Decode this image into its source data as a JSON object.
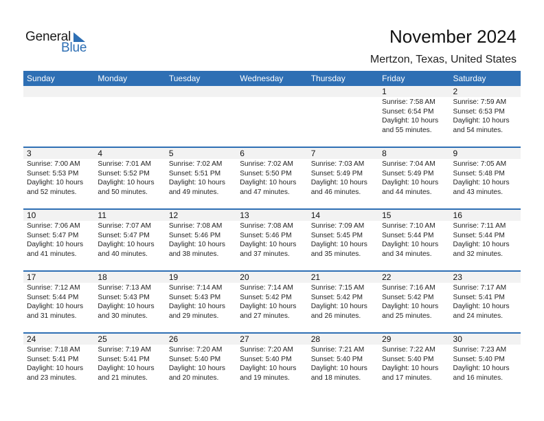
{
  "logo": {
    "line1": "General",
    "line2": "Blue"
  },
  "header": {
    "title": "November 2024",
    "location": "Mertzon, Texas, United States"
  },
  "weekdays": [
    "Sunday",
    "Monday",
    "Tuesday",
    "Wednesday",
    "Thursday",
    "Friday",
    "Saturday"
  ],
  "weeks": [
    [
      {
        "date": "",
        "sunrise": "",
        "sunset": "",
        "daylight1": "",
        "daylight2": ""
      },
      {
        "date": "",
        "sunrise": "",
        "sunset": "",
        "daylight1": "",
        "daylight2": ""
      },
      {
        "date": "",
        "sunrise": "",
        "sunset": "",
        "daylight1": "",
        "daylight2": ""
      },
      {
        "date": "",
        "sunrise": "",
        "sunset": "",
        "daylight1": "",
        "daylight2": ""
      },
      {
        "date": "",
        "sunrise": "",
        "sunset": "",
        "daylight1": "",
        "daylight2": ""
      },
      {
        "date": "1",
        "sunrise": "Sunrise: 7:58 AM",
        "sunset": "Sunset: 6:54 PM",
        "daylight1": "Daylight: 10 hours",
        "daylight2": "and 55 minutes."
      },
      {
        "date": "2",
        "sunrise": "Sunrise: 7:59 AM",
        "sunset": "Sunset: 6:53 PM",
        "daylight1": "Daylight: 10 hours",
        "daylight2": "and 54 minutes."
      }
    ],
    [
      {
        "date": "3",
        "sunrise": "Sunrise: 7:00 AM",
        "sunset": "Sunset: 5:53 PM",
        "daylight1": "Daylight: 10 hours",
        "daylight2": "and 52 minutes."
      },
      {
        "date": "4",
        "sunrise": "Sunrise: 7:01 AM",
        "sunset": "Sunset: 5:52 PM",
        "daylight1": "Daylight: 10 hours",
        "daylight2": "and 50 minutes."
      },
      {
        "date": "5",
        "sunrise": "Sunrise: 7:02 AM",
        "sunset": "Sunset: 5:51 PM",
        "daylight1": "Daylight: 10 hours",
        "daylight2": "and 49 minutes."
      },
      {
        "date": "6",
        "sunrise": "Sunrise: 7:02 AM",
        "sunset": "Sunset: 5:50 PM",
        "daylight1": "Daylight: 10 hours",
        "daylight2": "and 47 minutes."
      },
      {
        "date": "7",
        "sunrise": "Sunrise: 7:03 AM",
        "sunset": "Sunset: 5:49 PM",
        "daylight1": "Daylight: 10 hours",
        "daylight2": "and 46 minutes."
      },
      {
        "date": "8",
        "sunrise": "Sunrise: 7:04 AM",
        "sunset": "Sunset: 5:49 PM",
        "daylight1": "Daylight: 10 hours",
        "daylight2": "and 44 minutes."
      },
      {
        "date": "9",
        "sunrise": "Sunrise: 7:05 AM",
        "sunset": "Sunset: 5:48 PM",
        "daylight1": "Daylight: 10 hours",
        "daylight2": "and 43 minutes."
      }
    ],
    [
      {
        "date": "10",
        "sunrise": "Sunrise: 7:06 AM",
        "sunset": "Sunset: 5:47 PM",
        "daylight1": "Daylight: 10 hours",
        "daylight2": "and 41 minutes."
      },
      {
        "date": "11",
        "sunrise": "Sunrise: 7:07 AM",
        "sunset": "Sunset: 5:47 PM",
        "daylight1": "Daylight: 10 hours",
        "daylight2": "and 40 minutes."
      },
      {
        "date": "12",
        "sunrise": "Sunrise: 7:08 AM",
        "sunset": "Sunset: 5:46 PM",
        "daylight1": "Daylight: 10 hours",
        "daylight2": "and 38 minutes."
      },
      {
        "date": "13",
        "sunrise": "Sunrise: 7:08 AM",
        "sunset": "Sunset: 5:46 PM",
        "daylight1": "Daylight: 10 hours",
        "daylight2": "and 37 minutes."
      },
      {
        "date": "14",
        "sunrise": "Sunrise: 7:09 AM",
        "sunset": "Sunset: 5:45 PM",
        "daylight1": "Daylight: 10 hours",
        "daylight2": "and 35 minutes."
      },
      {
        "date": "15",
        "sunrise": "Sunrise: 7:10 AM",
        "sunset": "Sunset: 5:44 PM",
        "daylight1": "Daylight: 10 hours",
        "daylight2": "and 34 minutes."
      },
      {
        "date": "16",
        "sunrise": "Sunrise: 7:11 AM",
        "sunset": "Sunset: 5:44 PM",
        "daylight1": "Daylight: 10 hours",
        "daylight2": "and 32 minutes."
      }
    ],
    [
      {
        "date": "17",
        "sunrise": "Sunrise: 7:12 AM",
        "sunset": "Sunset: 5:44 PM",
        "daylight1": "Daylight: 10 hours",
        "daylight2": "and 31 minutes."
      },
      {
        "date": "18",
        "sunrise": "Sunrise: 7:13 AM",
        "sunset": "Sunset: 5:43 PM",
        "daylight1": "Daylight: 10 hours",
        "daylight2": "and 30 minutes."
      },
      {
        "date": "19",
        "sunrise": "Sunrise: 7:14 AM",
        "sunset": "Sunset: 5:43 PM",
        "daylight1": "Daylight: 10 hours",
        "daylight2": "and 29 minutes."
      },
      {
        "date": "20",
        "sunrise": "Sunrise: 7:14 AM",
        "sunset": "Sunset: 5:42 PM",
        "daylight1": "Daylight: 10 hours",
        "daylight2": "and 27 minutes."
      },
      {
        "date": "21",
        "sunrise": "Sunrise: 7:15 AM",
        "sunset": "Sunset: 5:42 PM",
        "daylight1": "Daylight: 10 hours",
        "daylight2": "and 26 minutes."
      },
      {
        "date": "22",
        "sunrise": "Sunrise: 7:16 AM",
        "sunset": "Sunset: 5:42 PM",
        "daylight1": "Daylight: 10 hours",
        "daylight2": "and 25 minutes."
      },
      {
        "date": "23",
        "sunrise": "Sunrise: 7:17 AM",
        "sunset": "Sunset: 5:41 PM",
        "daylight1": "Daylight: 10 hours",
        "daylight2": "and 24 minutes."
      }
    ],
    [
      {
        "date": "24",
        "sunrise": "Sunrise: 7:18 AM",
        "sunset": "Sunset: 5:41 PM",
        "daylight1": "Daylight: 10 hours",
        "daylight2": "and 23 minutes."
      },
      {
        "date": "25",
        "sunrise": "Sunrise: 7:19 AM",
        "sunset": "Sunset: 5:41 PM",
        "daylight1": "Daylight: 10 hours",
        "daylight2": "and 21 minutes."
      },
      {
        "date": "26",
        "sunrise": "Sunrise: 7:20 AM",
        "sunset": "Sunset: 5:40 PM",
        "daylight1": "Daylight: 10 hours",
        "daylight2": "and 20 minutes."
      },
      {
        "date": "27",
        "sunrise": "Sunrise: 7:20 AM",
        "sunset": "Sunset: 5:40 PM",
        "daylight1": "Daylight: 10 hours",
        "daylight2": "and 19 minutes."
      },
      {
        "date": "28",
        "sunrise": "Sunrise: 7:21 AM",
        "sunset": "Sunset: 5:40 PM",
        "daylight1": "Daylight: 10 hours",
        "daylight2": "and 18 minutes."
      },
      {
        "date": "29",
        "sunrise": "Sunrise: 7:22 AM",
        "sunset": "Sunset: 5:40 PM",
        "daylight1": "Daylight: 10 hours",
        "daylight2": "and 17 minutes."
      },
      {
        "date": "30",
        "sunrise": "Sunrise: 7:23 AM",
        "sunset": "Sunset: 5:40 PM",
        "daylight1": "Daylight: 10 hours",
        "daylight2": "and 16 minutes."
      }
    ]
  ],
  "colors": {
    "accent": "#2e6fb4",
    "strip": "#f2f2f2"
  }
}
